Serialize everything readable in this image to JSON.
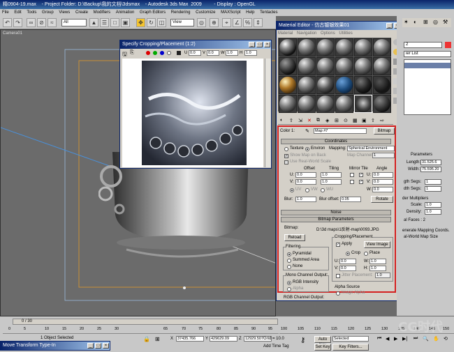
{
  "app": {
    "title": "精0904-19.max    - Project Folder: D:\\Backup\\我的文档\\3dsmax    - Autodesk 3ds Max  2009         - Display : OpenGL",
    "menus": [
      "File",
      "Edit",
      "Tools",
      "Group",
      "Views",
      "Create",
      "Modifiers",
      "Animation",
      "Graph Editors",
      "Rendering",
      "Customize",
      "MAXScript",
      "Help",
      "Tentacles"
    ],
    "selection_filter": "All",
    "ref_coord": "View"
  },
  "viewport": {
    "label": "Camera01"
  },
  "crop_window": {
    "title": "Specify Cropping/Placement (1:2)",
    "u_label": "U",
    "u_value": "0.0",
    "v_label": "V",
    "v_value": "0.0",
    "w_label": "W",
    "w_value": "1.0",
    "h_label": "H",
    "h_value": "1.0"
  },
  "material_editor": {
    "title": "Material Editor - 仿古镀银效果01",
    "menus": [
      "Material",
      "Navigation",
      "Options",
      "Utilities"
    ],
    "map_label": "Color 1:",
    "map_name": "Map #7",
    "map_type": "Bitmap",
    "coordinates": {
      "header": "Coordinates",
      "texture": "Texture",
      "environ": "Environ",
      "mapping_label": "Mapping:",
      "mapping_value": "Spherical Environment",
      "show_map_on_back": "Show Map on Back",
      "map_channel_label": "Map Channel:",
      "map_channel_value": "1",
      "use_real_world": "Use Real-World Scale",
      "col_offset": "Offset",
      "col_tiling": "Tiling",
      "col_mirror": "Mirror Tile",
      "col_angle": "Angle",
      "u": "U:",
      "v": "V:",
      "w": "W:",
      "u_offset": "0.0",
      "v_offset": "0.0",
      "u_tiling": "1.0",
      "v_tiling": "1.0",
      "u_angle": "0.0",
      "v_angle": "0.0",
      "w_angle": "0.0",
      "uv": "UV",
      "vw": "VW",
      "wu": "WU",
      "blur_label": "Blur:",
      "blur_value": "1.0",
      "blur_offset_label": "Blur offset:",
      "blur_offset_value": "0.05",
      "rotate": "Rotate"
    },
    "noise_header": "Noise",
    "bitmap_params": {
      "header": "Bitmap Parameters",
      "bitmap_label": "Bitmap:",
      "bitmap_path": "D:\\3d maps\\1反射-map\\0093.JPG",
      "reload": "Reload",
      "filtering": "Filtering",
      "pyramidal": "Pyramidal",
      "summed_area": "Summed Area",
      "none": "None",
      "mono_channel": "Mono Channel Output:",
      "rgb_intensity": "RGB Intensity",
      "alpha": "Alpha",
      "cropping": "Cropping/Placement",
      "apply": "Apply",
      "view_image": "View Image",
      "crop": "Crop",
      "place": "Place",
      "u": "U:",
      "v": "V:",
      "w": "W:",
      "h": "H:",
      "u_val": "0.0",
      "v_val": "0.0",
      "w_val": "1.0",
      "h_val": "1.0",
      "jitter": "Jitter Placement:",
      "jitter_val": "1.0",
      "alpha_source": "Alpha Source",
      "image_alpha": "Image Alpha",
      "rgb_channel": "RGB Channel Output:"
    }
  },
  "right_panel": {
    "number": "2",
    "modifier_list": "ier List",
    "parameters": "Parameters",
    "length_label": "Length:",
    "length_value": "31.525.6",
    "width_label": "Width:",
    "width_value": "75.595.20",
    "length_segs": "gth Segs:",
    "length_segs_value": "1",
    "width_segs": "dth Segs:",
    "width_segs_value": "1",
    "render_multipliers": "der Multipliers",
    "scale_label": "Scale:",
    "scale_value": "1.0",
    "density_label": "Density:",
    "density_value": "1.0",
    "total_faces": "al Faces : 2",
    "gen_mapping": "enerate Mapping Coords.",
    "real_world": "al-World Map Size"
  },
  "timeline": {
    "frame": "0 / 30",
    "ticks": [
      "0",
      "5",
      "10",
      "15",
      "20",
      "25",
      "30",
      "65",
      "70",
      "75",
      "80",
      "85",
      "90",
      "95",
      "100",
      "105",
      "110",
      "115",
      "120",
      "125",
      "130",
      "135",
      "140",
      "145",
      "150",
      "155",
      "160",
      "165"
    ]
  },
  "status": {
    "selected": "1 Object Selected",
    "x": "37435.766",
    "y": "429629.09",
    "z": "12929.507",
    "grid": "Grid = 10.0",
    "add_time_tag": "Add Time Tag",
    "auto_key": "Auto Key",
    "set_key": "Set Key",
    "selected_combo": "Selected",
    "key_filters": "Key Filters...",
    "maxscript": "Move Transform Type-In"
  },
  "watermark": "CG时代"
}
